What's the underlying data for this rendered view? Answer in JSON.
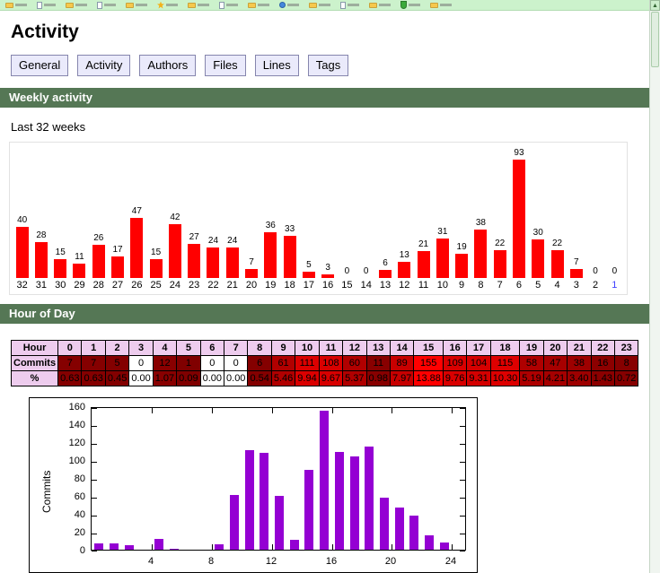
{
  "page": {
    "title": "Activity"
  },
  "browser": {
    "scroll_up_arrow": "▲",
    "bookmark_icons": [
      "folder",
      "page",
      "folder",
      "page",
      "folder",
      "star",
      "folder",
      "page",
      "folder",
      "globe",
      "folder",
      "page",
      "folder",
      "shield",
      "folder"
    ]
  },
  "tabs": [
    {
      "label": "General"
    },
    {
      "label": "Activity"
    },
    {
      "label": "Authors"
    },
    {
      "label": "Files"
    },
    {
      "label": "Lines"
    },
    {
      "label": "Tags"
    }
  ],
  "sections": {
    "weekly": {
      "header": "Weekly activity",
      "subtitle": "Last 32 weeks"
    },
    "hour_of_day": {
      "header": "Hour of Day",
      "table": {
        "row_headers": [
          "Hour",
          "Commits",
          "%"
        ],
        "hours": [
          0,
          1,
          2,
          3,
          4,
          5,
          6,
          7,
          8,
          9,
          10,
          11,
          12,
          13,
          14,
          15,
          16,
          17,
          18,
          19,
          20,
          21,
          22,
          23
        ],
        "commits": [
          7,
          7,
          5,
          0,
          12,
          1,
          0,
          0,
          6,
          61,
          111,
          108,
          60,
          11,
          89,
          155,
          109,
          104,
          115,
          58,
          47,
          38,
          16,
          8
        ],
        "percents": [
          "0.63",
          "0.63",
          "0.45",
          "0.00",
          "1.07",
          "0.09",
          "0.00",
          "0.00",
          "0.54",
          "5.46",
          "9.94",
          "9.67",
          "5.37",
          "0.98",
          "7.97",
          "13.88",
          "9.76",
          "9.31",
          "10.30",
          "5.19",
          "4.21",
          "3.40",
          "1.43",
          "0.72"
        ]
      }
    }
  },
  "chart_data": [
    {
      "type": "bar",
      "title": "Weekly activity",
      "subtitle": "Last 32 weeks",
      "categories": [
        "32",
        "31",
        "30",
        "29",
        "28",
        "27",
        "26",
        "25",
        "24",
        "23",
        "22",
        "21",
        "20",
        "19",
        "18",
        "17",
        "16",
        "15",
        "14",
        "13",
        "12",
        "11",
        "10",
        "9",
        "8",
        "7",
        "6",
        "5",
        "4",
        "3",
        "2",
        "1"
      ],
      "values": [
        40,
        28,
        15,
        11,
        26,
        17,
        47,
        15,
        42,
        27,
        24,
        24,
        7,
        36,
        33,
        5,
        3,
        0,
        0,
        6,
        13,
        21,
        31,
        19,
        38,
        22,
        93,
        30,
        22,
        7,
        0,
        0
      ],
      "ylim": [
        0,
        93
      ],
      "bar_color": "#ff0000",
      "legend": "none",
      "grid": false
    },
    {
      "type": "bar",
      "title": "Hour of Day",
      "x": [
        0,
        1,
        2,
        3,
        4,
        5,
        6,
        7,
        8,
        9,
        10,
        11,
        12,
        13,
        14,
        15,
        16,
        17,
        18,
        19,
        20,
        21,
        22,
        23
      ],
      "values": [
        7,
        7,
        5,
        0,
        12,
        1,
        0,
        0,
        6,
        61,
        111,
        108,
        60,
        11,
        89,
        155,
        109,
        104,
        115,
        58,
        47,
        38,
        16,
        8
      ],
      "ylabel": "Commits",
      "xlabel": "",
      "ylim": [
        0,
        160
      ],
      "yticks": [
        0,
        20,
        40,
        60,
        80,
        100,
        120,
        140,
        160
      ],
      "xticks": [
        4,
        8,
        12,
        16,
        20,
        24
      ],
      "bar_color": "#9400d3",
      "legend": "none",
      "grid": false
    }
  ],
  "colors": {
    "section_header_green": "#557755",
    "bookmarks_bar_green": "#ccf2cc",
    "tab_bg": "#eaeafb",
    "tab_border": "#8585ad",
    "table_header_bg": "#eeccee",
    "heat_low": "#7f0000",
    "heat_high": "#ff0000",
    "weekly_bar_red": "#ff0000",
    "hour_bar_purple": "#9400d3"
  }
}
